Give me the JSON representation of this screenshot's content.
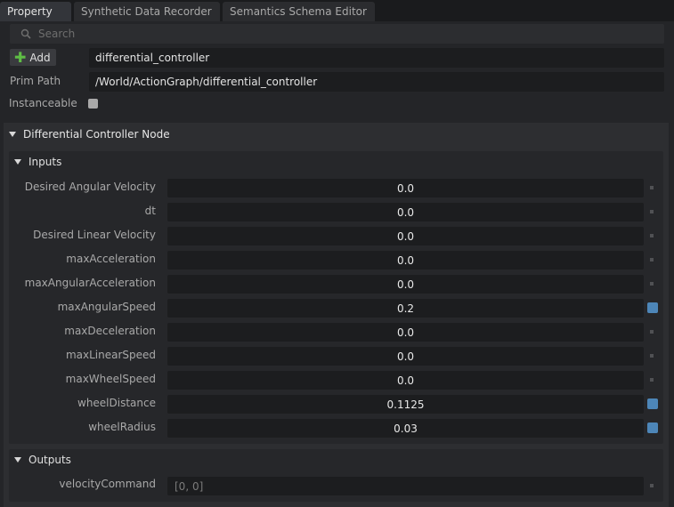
{
  "tabs": [
    "Property",
    "Synthetic Data Recorder",
    "Semantics Schema Editor"
  ],
  "search": {
    "placeholder": "Search"
  },
  "add_label": "Add",
  "name_value": "differential_controller",
  "prim_path": {
    "label": "Prim Path",
    "value": "/World/ActionGraph/differential_controller"
  },
  "instanceable": {
    "label": "Instanceable",
    "checked": false
  },
  "node": {
    "title": "Differential Controller Node",
    "inputs_title": "Inputs",
    "inputs": [
      {
        "label": "Desired Angular Velocity",
        "value": "0.0",
        "modified": false
      },
      {
        "label": "dt",
        "value": "0.0",
        "modified": false
      },
      {
        "label": "Desired Linear Velocity",
        "value": "0.0",
        "modified": false
      },
      {
        "label": "maxAcceleration",
        "value": "0.0",
        "modified": false
      },
      {
        "label": "maxAngularAcceleration",
        "value": "0.0",
        "modified": false
      },
      {
        "label": "maxAngularSpeed",
        "value": "0.2",
        "modified": true
      },
      {
        "label": "maxDeceleration",
        "value": "0.0",
        "modified": false
      },
      {
        "label": "maxLinearSpeed",
        "value": "0.0",
        "modified": false
      },
      {
        "label": "maxWheelSpeed",
        "value": "0.0",
        "modified": false
      },
      {
        "label": "wheelDistance",
        "value": "0.1125",
        "modified": true
      },
      {
        "label": "wheelRadius",
        "value": "0.03",
        "modified": true
      }
    ],
    "outputs_title": "Outputs",
    "outputs": [
      {
        "label": "velocityCommand",
        "value": "[0, 0]",
        "modified": false
      }
    ]
  },
  "colors": {
    "modified": "#4d86b8",
    "add_plus": "#5fbd45"
  }
}
